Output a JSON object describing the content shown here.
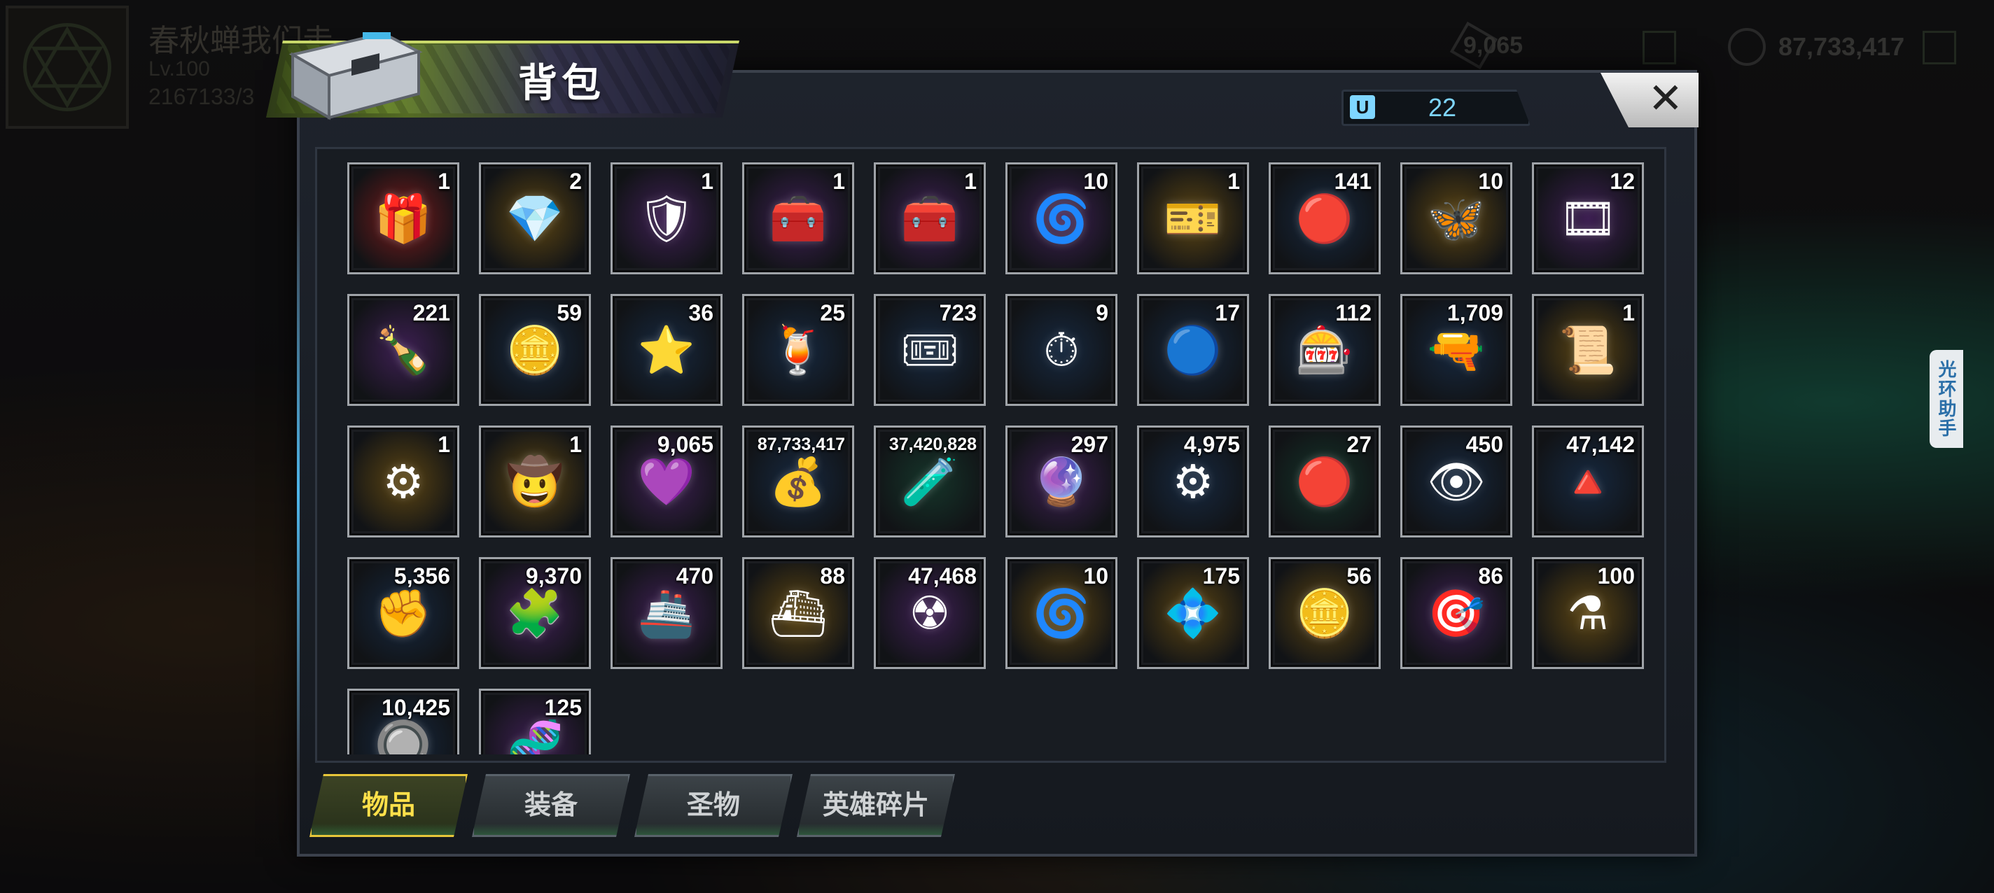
{
  "hud": {
    "player_name": "春秋蝉我们走",
    "level": "Lv.100",
    "exp": "2167133/3",
    "resource_1": "9,065",
    "resource_2": "87,733,417"
  },
  "side_helper": {
    "label": "光环助手"
  },
  "bag": {
    "title": "背包",
    "capacity": "22",
    "capacity_icon": "U",
    "close_label": "✕"
  },
  "items": [
    {
      "count": "1",
      "icon": "🎁",
      "rarity": "red"
    },
    {
      "count": "2",
      "icon": "💎",
      "rarity": "gold"
    },
    {
      "count": "1",
      "icon": "🛡",
      "rarity": "purple"
    },
    {
      "count": "1",
      "icon": "🧰",
      "rarity": "purple"
    },
    {
      "count": "1",
      "icon": "🧰",
      "rarity": "purple"
    },
    {
      "count": "10",
      "icon": "🌀",
      "rarity": "purple"
    },
    {
      "count": "1",
      "icon": "🎫",
      "rarity": "gold"
    },
    {
      "count": "141",
      "icon": "🔴",
      "rarity": "blue"
    },
    {
      "count": "10",
      "icon": "🦋",
      "rarity": "gold"
    },
    {
      "count": "12",
      "icon": "🎞",
      "rarity": "purple"
    },
    {
      "count": "221",
      "icon": "🍾",
      "rarity": "purple"
    },
    {
      "count": "59",
      "icon": "🪙",
      "rarity": "blue"
    },
    {
      "count": "36",
      "icon": "⭐",
      "rarity": "blue"
    },
    {
      "count": "25",
      "icon": "🍹",
      "rarity": "blue"
    },
    {
      "count": "723",
      "icon": "🎟",
      "rarity": "blue"
    },
    {
      "count": "9",
      "icon": "⏱",
      "rarity": "blue"
    },
    {
      "count": "17",
      "icon": "🔵",
      "rarity": "blue"
    },
    {
      "count": "112",
      "icon": "🎰",
      "rarity": "blue"
    },
    {
      "count": "1,709",
      "icon": "🔫",
      "rarity": "blue"
    },
    {
      "count": "1",
      "icon": "📜",
      "rarity": "gold"
    },
    {
      "count": "1",
      "icon": "⚙",
      "rarity": "gold"
    },
    {
      "count": "1",
      "icon": "🤠",
      "rarity": "gold"
    },
    {
      "count": "9,065",
      "icon": "💜",
      "rarity": "purple"
    },
    {
      "count": "87,733,417",
      "icon": "💰",
      "rarity": "blue",
      "small": true
    },
    {
      "count": "37,420,828",
      "icon": "🧪",
      "rarity": "green",
      "small": true
    },
    {
      "count": "297",
      "icon": "🔮",
      "rarity": "purple"
    },
    {
      "count": "4,975",
      "icon": "⚙",
      "rarity": "blue"
    },
    {
      "count": "27",
      "icon": "🔴",
      "rarity": "green"
    },
    {
      "count": "450",
      "icon": "👁",
      "rarity": "blue"
    },
    {
      "count": "47,142",
      "icon": "🔺",
      "rarity": "blue"
    },
    {
      "count": "5,356",
      "icon": "✊",
      "rarity": "blue"
    },
    {
      "count": "9,370",
      "icon": "🧩",
      "rarity": "purple"
    },
    {
      "count": "470",
      "icon": "🚢",
      "rarity": "purple"
    },
    {
      "count": "88",
      "icon": "⛴",
      "rarity": "gold"
    },
    {
      "count": "47,468",
      "icon": "☢",
      "rarity": "purple"
    },
    {
      "count": "10",
      "icon": "🌀",
      "rarity": "gold"
    },
    {
      "count": "175",
      "icon": "💠",
      "rarity": "gold"
    },
    {
      "count": "56",
      "icon": "🪙",
      "rarity": "gold"
    },
    {
      "count": "86",
      "icon": "🎯",
      "rarity": "purple"
    },
    {
      "count": "100",
      "icon": "⚗",
      "rarity": "gold"
    },
    {
      "count": "10,425",
      "icon": "🔘",
      "rarity": "blue"
    },
    {
      "count": "125",
      "icon": "🧬",
      "rarity": "purple"
    }
  ],
  "tabs": [
    {
      "label": "物品",
      "active": true
    },
    {
      "label": "装备",
      "active": false
    },
    {
      "label": "圣物",
      "active": false
    },
    {
      "label": "英雄碎片",
      "active": false
    }
  ],
  "colors": {
    "rarity_red": "#7a1a1a",
    "rarity_gold": "#5c4512",
    "rarity_purple": "#3d1f52",
    "rarity_blue": "#16283f",
    "rarity_green": "#15352a",
    "accent_yellow": "#ffe04a",
    "accent_cyan": "#7fd6ff"
  }
}
